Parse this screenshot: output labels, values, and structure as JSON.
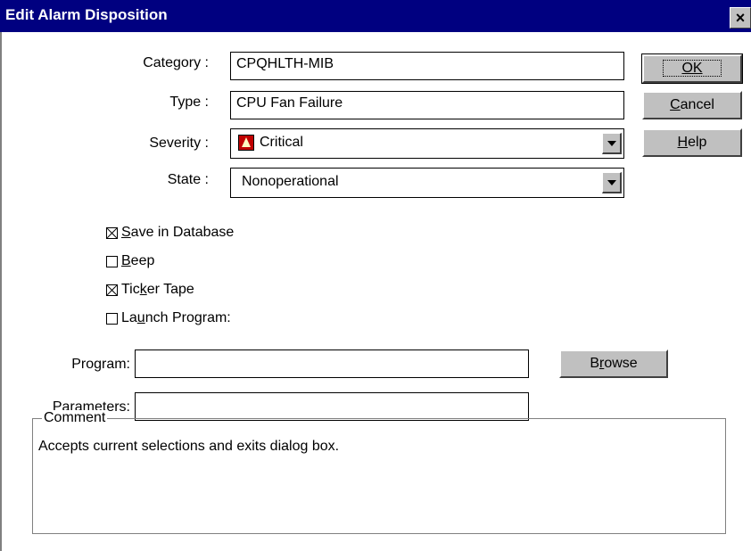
{
  "window": {
    "title": "Edit Alarm Disposition",
    "close_label": "×"
  },
  "form": {
    "category": {
      "label": "Category :",
      "value": "CPQHLTH-MIB"
    },
    "type": {
      "label": "Type :",
      "value": "CPU Fan Failure"
    },
    "severity": {
      "label": "Severity :",
      "value": "Critical",
      "icon": "bell-icon",
      "icon_color": "#c00000"
    },
    "state": {
      "label": "State :",
      "value": "Nonoperational"
    }
  },
  "buttons": {
    "ok": "OK",
    "cancel": "Cancel",
    "help": "Help",
    "browse": "Browse"
  },
  "checkboxes": [
    {
      "label_pre": "",
      "label_u": "S",
      "label_post": "ave in Database",
      "checked": true
    },
    {
      "label_pre": "",
      "label_u": "B",
      "label_post": "eep",
      "checked": false
    },
    {
      "label_pre": "Tic",
      "label_u": "k",
      "label_post": "er Tape",
      "checked": true
    },
    {
      "label_pre": "La",
      "label_u": "u",
      "label_post": "nch Program:",
      "checked": false
    }
  ],
  "program": {
    "label": "Program:",
    "value": ""
  },
  "parameters": {
    "label": "Parameters:",
    "value": ""
  },
  "comment": {
    "legend": "Comment",
    "text": "Accepts current selections and exits dialog box."
  }
}
